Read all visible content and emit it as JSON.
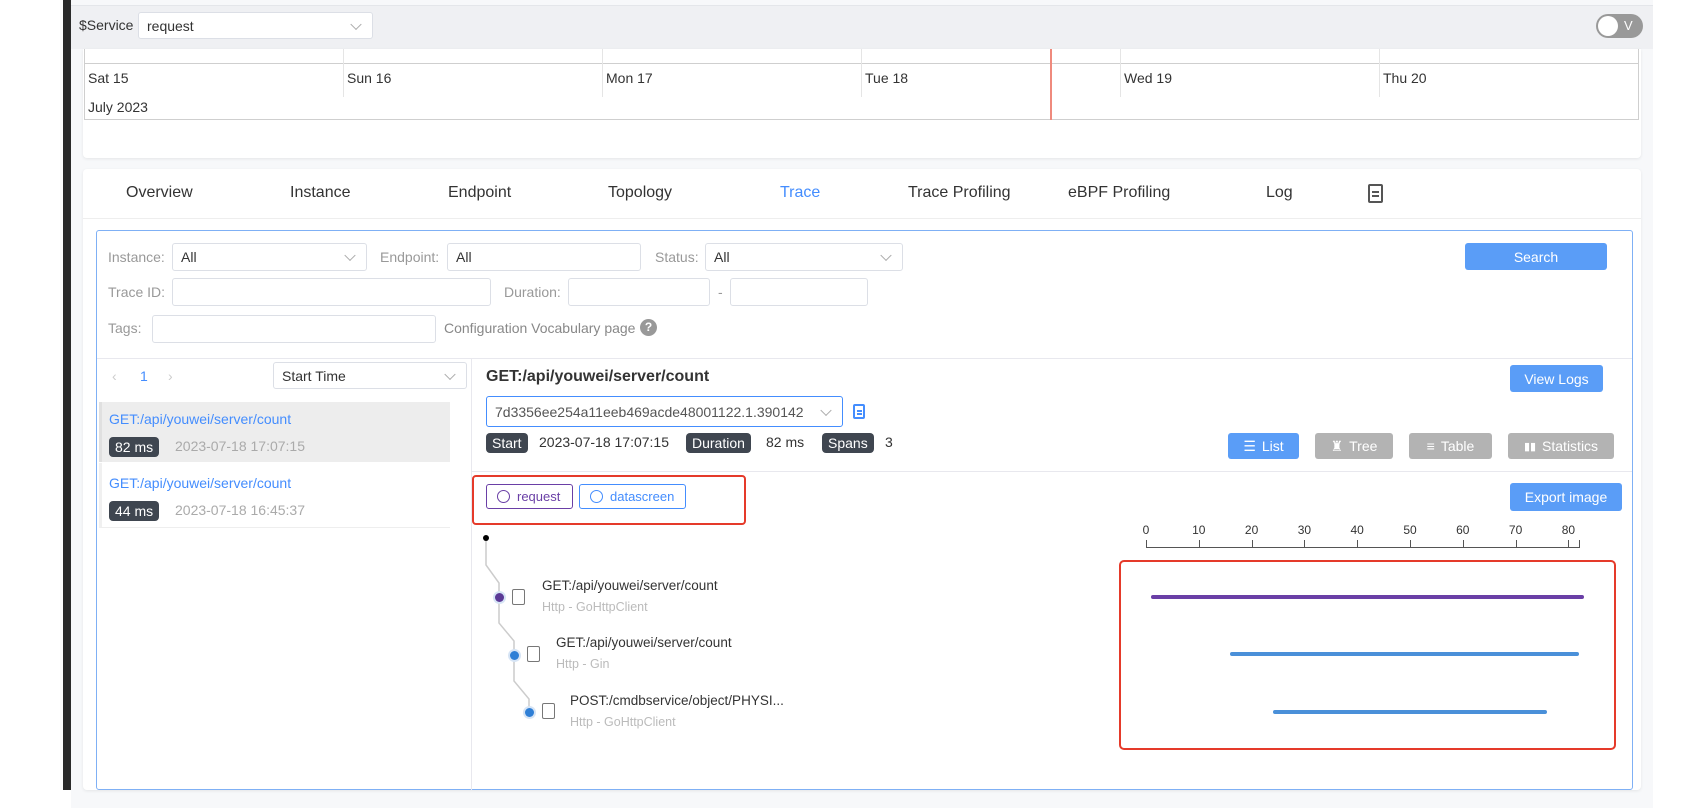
{
  "header": {
    "service_label": "$Service",
    "service_value": "request",
    "toggle_label": "V"
  },
  "calendar": {
    "days": [
      "Sat 15",
      "Sun 16",
      "Mon 17",
      "Tue 18",
      "Wed 19",
      "Thu 20"
    ],
    "month": "July 2023"
  },
  "tabs": [
    {
      "label": "Overview"
    },
    {
      "label": "Instance"
    },
    {
      "label": "Endpoint"
    },
    {
      "label": "Topology"
    },
    {
      "label": "Trace",
      "active": true
    },
    {
      "label": "Trace Profiling"
    },
    {
      "label": "eBPF Profiling"
    },
    {
      "label": "Log"
    }
  ],
  "filters": {
    "instance_label": "Instance:",
    "instance_value": "All",
    "endpoint_label": "Endpoint:",
    "endpoint_value": "All",
    "status_label": "Status:",
    "status_value": "All",
    "traceid_label": "Trace ID:",
    "traceid_value": "",
    "duration_label": "Duration:",
    "duration_min": "",
    "duration_sep": "-",
    "duration_max": "",
    "tags_label": "Tags:",
    "tags_value": "",
    "vocab_link": "Configuration Vocabulary page",
    "help_icon": "?",
    "search_label": "Search"
  },
  "list": {
    "page": "1",
    "sort_value": "Start Time",
    "items": [
      {
        "title": "GET:/api/youwei/server/count",
        "duration": "82 ms",
        "time": "2023-07-18 17:07:15",
        "selected": true
      },
      {
        "title": "GET:/api/youwei/server/count",
        "duration": "44 ms",
        "time": "2023-07-18 16:45:37"
      }
    ]
  },
  "detail": {
    "title": "GET:/api/youwei/server/count",
    "trace_id": "7d3356ee254a11eeb469acde48001122.1.390142",
    "view_logs": "View Logs",
    "start_label": "Start",
    "start_value": "2023-07-18 17:07:15",
    "duration_label": "Duration",
    "duration_value": "82 ms",
    "spans_label": "Spans",
    "spans_value": "3",
    "views": [
      {
        "label": "List",
        "active": true
      },
      {
        "label": "Tree"
      },
      {
        "label": "Table"
      },
      {
        "label": "Statistics"
      }
    ],
    "services": [
      {
        "label": "request",
        "color": "#6a3fa6"
      },
      {
        "label": "datascreen",
        "color": "#448dfe"
      }
    ],
    "export_label": "Export image",
    "spans": [
      {
        "name": "GET:/api/youwei/server/count",
        "sub": "Http - GoHttpClient",
        "color": "#5b3a96",
        "icon": "exit-icon"
      },
      {
        "name": "GET:/api/youwei/server/count",
        "sub": "Http - Gin",
        "color": "#2f7fd6",
        "icon": "entry-icon"
      },
      {
        "name": "POST:/cmdbservice/object/PHYSI...",
        "sub": "Http - GoHttpClient",
        "color": "#2f7fd6",
        "icon": "exit-icon"
      }
    ]
  },
  "chart_data": {
    "type": "bar",
    "orientation": "horizontal-gantt",
    "xlim": [
      0,
      82
    ],
    "ticks": [
      "0",
      "10",
      "20",
      "30",
      "40",
      "50",
      "60",
      "70",
      "80"
    ],
    "series": [
      {
        "start": 1,
        "end": 83,
        "color": "#6a3fa6"
      },
      {
        "start": 16,
        "end": 82,
        "color": "#4a90d9"
      },
      {
        "start": 24,
        "end": 76,
        "color": "#4a90d9"
      }
    ]
  },
  "colors": {
    "accent": "#448dfe",
    "highlight_box": "#e53a2a"
  }
}
